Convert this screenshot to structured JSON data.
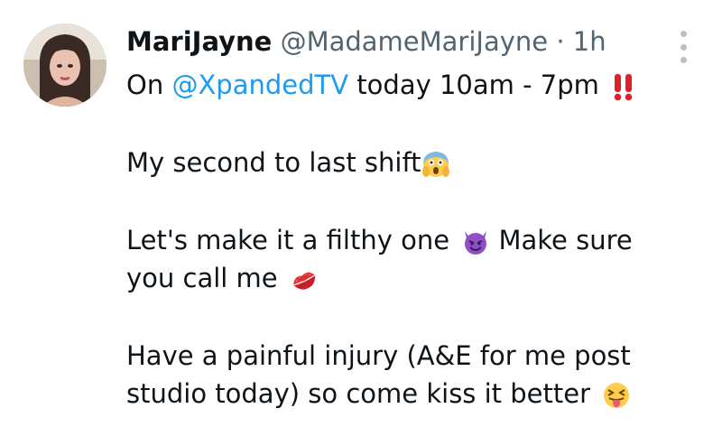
{
  "tweet": {
    "author_name": "MariJayne",
    "handle": "@MadameMariJayne",
    "separator": "·",
    "time": "1h",
    "line1": {
      "prefix": "On ",
      "mention": "@XpandedTV",
      "suffix": " today 10am - 7pm "
    },
    "line2": "My second to last shift",
    "line3": "Let's make it a filthy one ",
    "line3b": " Make sure",
    "line4": "you call me ",
    "line5": "Have a painful injury (A&E for me post",
    "line6": "studio today) so come kiss it better "
  },
  "icons": {
    "more": "more-options-icon",
    "double_exclamation": "double-exclamation-emoji",
    "scream": "screaming-face-emoji",
    "devil": "smiling-devil-emoji",
    "kiss": "kiss-mark-emoji",
    "tongue": "squinting-tongue-emoji"
  },
  "colors": {
    "link": "#1d9bf0",
    "secondary": "#536471",
    "text": "#0f1419"
  }
}
